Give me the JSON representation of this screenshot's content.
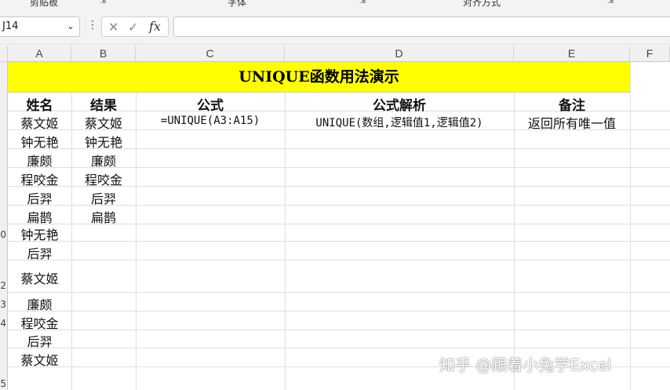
{
  "ribbon": {
    "labels": [
      "剪贴板",
      "字体",
      "对齐方式"
    ]
  },
  "formula_bar": {
    "name_box": "J14",
    "cancel_icon": "close-icon",
    "enter_icon": "check-icon",
    "fx_label": "fx",
    "formula": ""
  },
  "sheet": {
    "columns": [
      "A",
      "B",
      "C",
      "D",
      "E",
      "F"
    ],
    "title": "UNIQUE函数用法演示",
    "headers": {
      "name": "姓名",
      "result": "结果",
      "formula": "公式",
      "analysis": "公式解析",
      "note": "备注"
    },
    "names": [
      "蔡文姬",
      "钟无艳",
      "廉颇",
      "程咬金",
      "后羿",
      "扁鹊",
      "钟无艳",
      "后羿",
      "蔡文姬",
      "廉颇",
      "程咬金",
      "后羿",
      "蔡文姬"
    ],
    "results": [
      "蔡文姬",
      "钟无艳",
      "廉颇",
      "程咬金",
      "后羿",
      "扁鹊"
    ],
    "formula_text": "=UNIQUE(A3:A15)",
    "analysis_text": "UNIQUE(数组,逻辑值1,逻辑值2)",
    "note_text": "返回所有唯一值",
    "row_labels": [
      "",
      "",
      "",
      "",
      "",
      "",
      "",
      "",
      "0",
      "",
      "2",
      "3",
      "4",
      "5"
    ]
  },
  "watermark": "知乎 @跟着小兔学Excel",
  "colors": {
    "title_fill": "#ffff00",
    "gridline": "#dedede",
    "header_bg": "#f0f0f0"
  }
}
